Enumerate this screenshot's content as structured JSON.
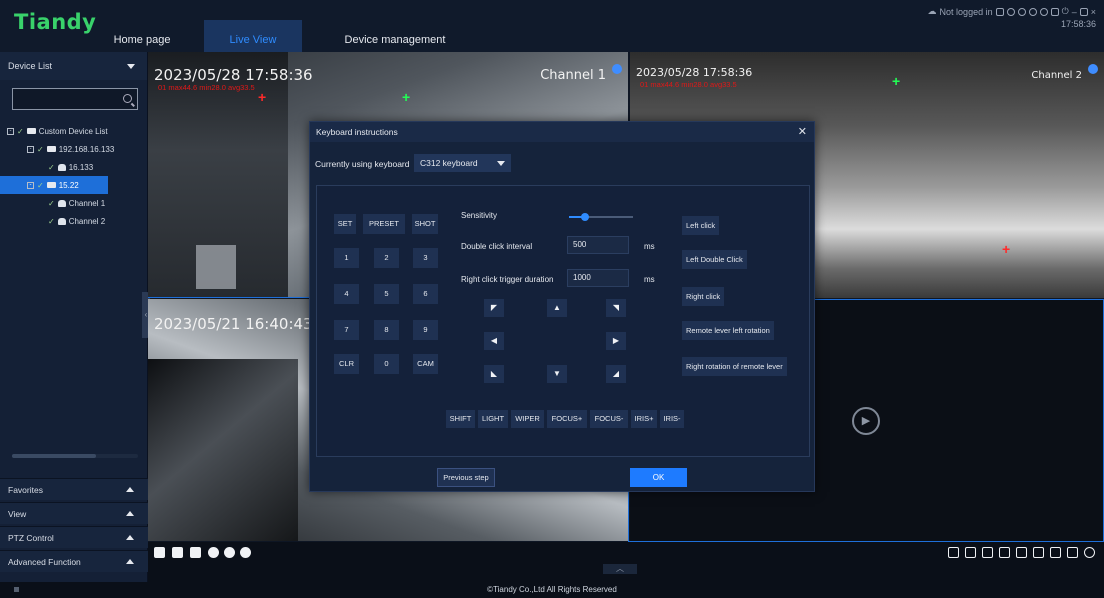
{
  "app": {
    "logo": "Tiandy",
    "nav": [
      "Home page",
      "Live View",
      "Device management"
    ],
    "login_status": "Not logged in",
    "clock": "17:58:36"
  },
  "sidebar": {
    "header": "Device List",
    "search_placeholder": "",
    "tree": [
      {
        "label": "Custom Device List"
      },
      {
        "label": "192.168.16.133"
      },
      {
        "label": "16.133"
      },
      {
        "label": "15.22"
      },
      {
        "label": "Channel 1"
      },
      {
        "label": "Channel 2"
      }
    ],
    "sections": [
      "Favorites",
      "View",
      "PTZ Control",
      "Advanced Function"
    ]
  },
  "videos": [
    {
      "timestamp": "2023/05/28 17:58:36",
      "temp": "01 max44.6 min28.0 avg33.5",
      "channel": "Channel 1"
    },
    {
      "timestamp": "2023/05/28 17:58:36",
      "temp": "01 max44.6 min28.0 avg33.5",
      "channel": "Channel 2"
    },
    {
      "timestamp": "2023/05/21 16:40:43",
      "temp": "",
      "channel": ""
    }
  ],
  "dialog": {
    "title": "Keyboard instructions",
    "keyboard_label": "Currently using keyboard",
    "keyboard_value": "C312 keyboard",
    "keys_top": [
      "SET",
      "PRESET",
      "SHOT"
    ],
    "keys_num": [
      "1",
      "2",
      "3",
      "4",
      "5",
      "6",
      "7",
      "8",
      "9"
    ],
    "keys_bottom": [
      "CLR",
      "0",
      "CAM"
    ],
    "sensitivity_label": "Sensitivity",
    "sensitivity_level": 0.25,
    "double_click_label": "Double click interval",
    "double_click_value": "500",
    "double_click_unit": "ms",
    "right_click_label": "Right click trigger duration",
    "right_click_value": "1000",
    "right_click_unit": "ms",
    "right_actions": [
      "Left click",
      "Left Double Click",
      "Right click",
      "Remote lever left rotation",
      "Right rotation of remote lever"
    ],
    "func_keys": [
      "SHIFT",
      "LIGHT",
      "WIPER",
      "FOCUS+",
      "FOCUS-",
      "IRIS+",
      "IRIS-"
    ],
    "prev_label": "Previous step",
    "ok_label": "OK"
  },
  "footer": {
    "copyright": "©Tiandy Co.,Ltd All Rights Reserved"
  },
  "colors": {
    "accent": "#1e7bff",
    "logo": "#39d26b",
    "temp_text": "#e01818"
  }
}
